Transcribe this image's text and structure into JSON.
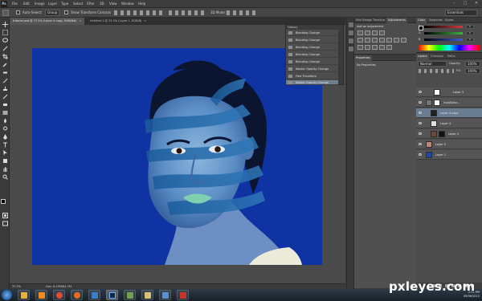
{
  "app": {
    "logo": "Ps",
    "menus": [
      "File",
      "Edit",
      "Image",
      "Layer",
      "Type",
      "Select",
      "Filter",
      "3D",
      "View",
      "Window",
      "Help"
    ],
    "workspace": "Essentials"
  },
  "options_bar": {
    "tool": "Ps",
    "auto_select_label": "Auto-Select:",
    "auto_select_value": "Group",
    "transform_label": "Show Transform Controls",
    "mode_3d": "3D Mode:"
  },
  "doc_tabs": [
    {
      "label": "tutorial.psd @ 37.5% (Layer 4 copy, RGB/8#)",
      "active": true
    },
    {
      "label": "Untitled-1 @ 33.3% (Layer 1, RGB/8)",
      "active": false
    }
  ],
  "status": {
    "zoom": "37.5%",
    "doc": "Doc: 6.45M/84.7M"
  },
  "history": {
    "title": "History",
    "rows": [
      {
        "label": "Blending Change",
        "selected": false
      },
      {
        "label": "Blending Change",
        "selected": false
      },
      {
        "label": "Blending Change",
        "selected": false
      },
      {
        "label": "Blending Change",
        "selected": false
      },
      {
        "label": "Blending Change",
        "selected": false
      },
      {
        "label": "Master Opacity Change",
        "selected": false
      },
      {
        "label": "Free Transform",
        "selected": false
      },
      {
        "label": "Master Opacity Change",
        "selected": true
      }
    ]
  },
  "adjustments": {
    "tabs": [
      "Mini Bridge",
      "Timeline",
      "Adjustments"
    ],
    "active_tab": 2,
    "title": "Add an adjustment"
  },
  "properties": {
    "tab": "Properties",
    "subtitle": "No Properties"
  },
  "color": {
    "tabs": [
      "Color",
      "Swatches",
      "Styles"
    ],
    "sliders": [
      {
        "label": "R",
        "value": "0",
        "color": "#d43b3b"
      },
      {
        "label": "G",
        "value": "0",
        "color": "#3bb43b"
      },
      {
        "label": "B",
        "value": "0",
        "color": "#3b5fd4"
      }
    ]
  },
  "layers": {
    "tabs": [
      "Layers",
      "Channels",
      "Paths"
    ],
    "blend_mode": "Normal",
    "opacity_label": "Opacity:",
    "opacity": "100%",
    "fill_label": "Fill:",
    "fill": "100%",
    "rows": [
      {
        "name": "Layer 3",
        "thumb": "#ffffff",
        "selected": false
      },
      {
        "name": "Hue/Satur...",
        "thumb": "#ffffff",
        "selected": false
      },
      {
        "name": "Layer 4 copy",
        "thumb": "#202020",
        "selected": true
      },
      {
        "name": "Layer 4",
        "thumb": "#e0e0e0",
        "selected": false
      },
      {
        "name": "Layer 2",
        "thumb": "#6a4a3a",
        "selected": false
      },
      {
        "name": "Layer 0",
        "thumb": "#b8887a",
        "selected": false
      },
      {
        "name": "Layer 1",
        "thumb": "#1a47a8",
        "selected": false
      }
    ]
  },
  "taskbar": {
    "apps": [
      {
        "name": "explorer-icon",
        "color": "#e4b23a"
      },
      {
        "name": "media-player-icon",
        "color": "#f08a1c"
      },
      {
        "name": "chrome-icon",
        "color": "#e24b35"
      },
      {
        "name": "firefox-icon",
        "color": "#e86a1e"
      },
      {
        "name": "pixel-icon",
        "color": "#3b7ec7"
      },
      {
        "name": "photoshop-icon",
        "color": "#0f2743"
      },
      {
        "name": "notepad-icon",
        "color": "#6fa34a"
      },
      {
        "name": "folder-icon",
        "color": "#d9c27a"
      },
      {
        "name": "mail-icon",
        "color": "#5b8fd3"
      },
      {
        "name": "acrobat-icon",
        "color": "#c8342b"
      }
    ],
    "time": "2:31 PM",
    "date": "09/06/2012"
  },
  "watermark": "pxleyes.com",
  "colors": {
    "canvas_blue": "#0f33a3",
    "selection": "#6a7c91",
    "bg": "#3b3b3b"
  }
}
